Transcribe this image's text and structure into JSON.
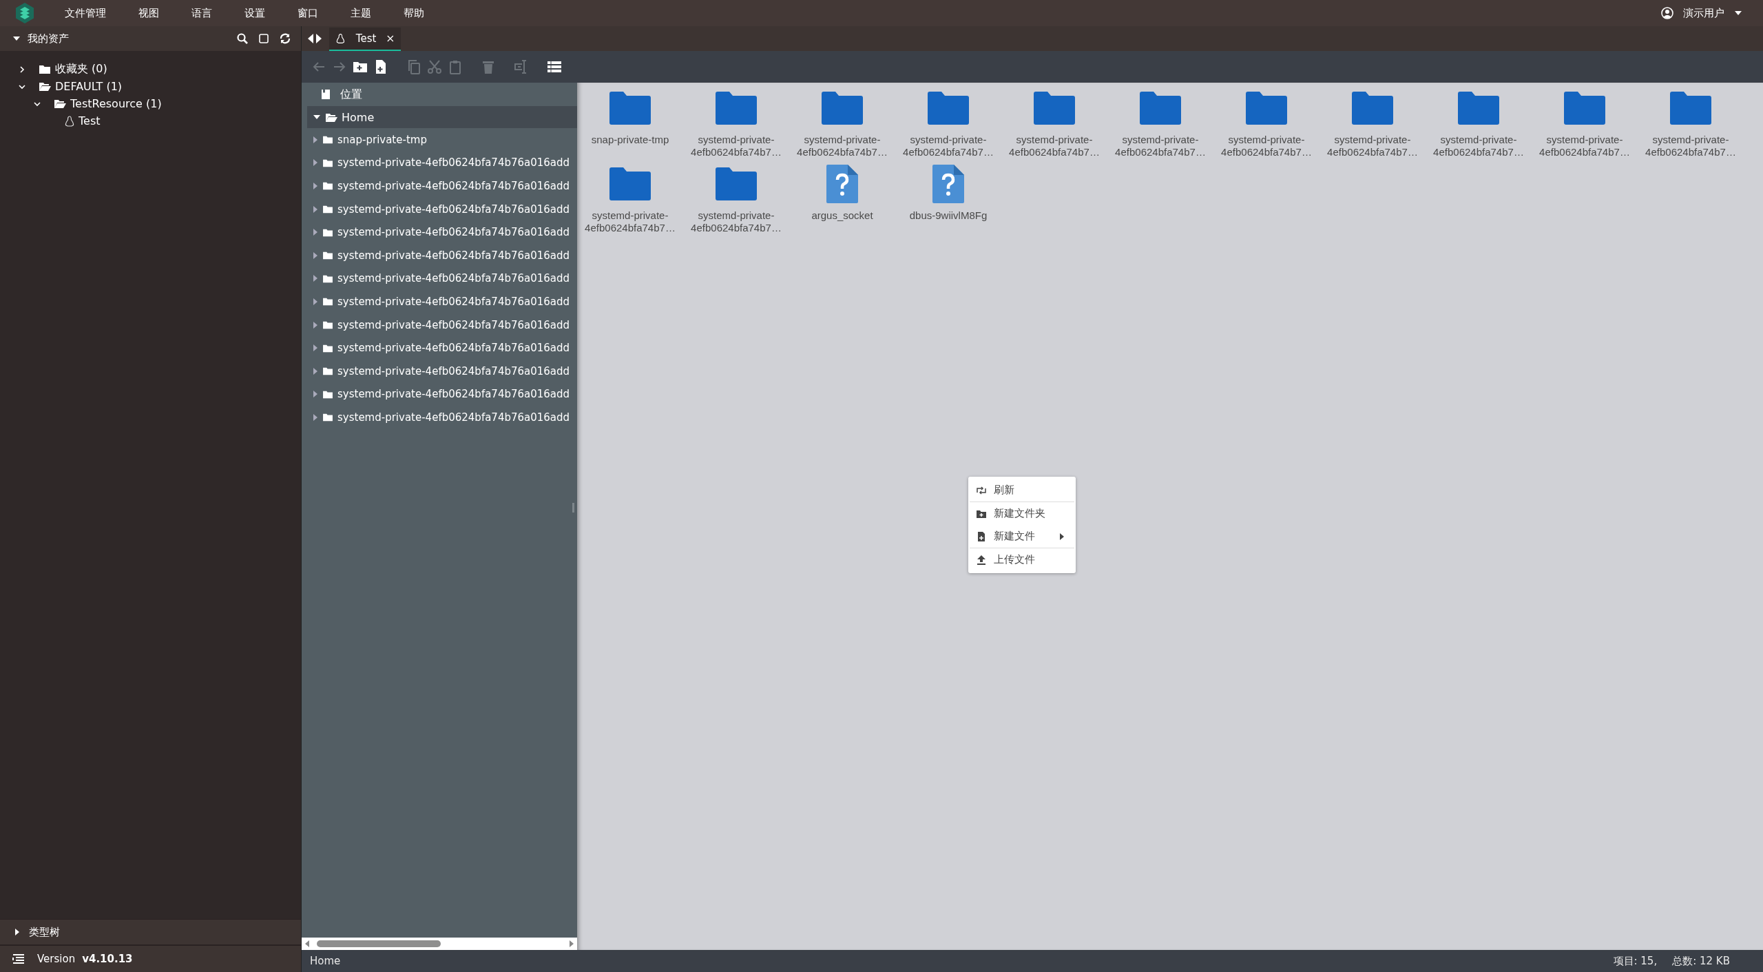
{
  "menu_bar": {
    "items": [
      "文件管理",
      "视图",
      "语言",
      "设置",
      "窗口",
      "主题",
      "帮助"
    ],
    "user": "演示用户"
  },
  "sidebar": {
    "title": "我的资产",
    "tree": [
      {
        "label": "收藏夹 (0)",
        "kind": "folder",
        "expanded": false
      },
      {
        "label": "DEFAULT (1)",
        "kind": "folder",
        "expanded": true,
        "children": [
          {
            "label": "TestResource (1)",
            "kind": "folder",
            "expanded": true,
            "children": [
              {
                "label": "Test",
                "kind": "linux"
              }
            ]
          }
        ]
      }
    ],
    "type_tree": {
      "label": "类型树",
      "expanded": false
    },
    "version": {
      "label": "Version",
      "value": "v4.10.13"
    }
  },
  "tabs": [
    {
      "label": "Test",
      "selected": true
    }
  ],
  "toolbar": [
    {
      "kind": "back",
      "disabled": true
    },
    {
      "kind": "forward",
      "disabled": true
    },
    {
      "kind": "new-folder",
      "disabled": false
    },
    {
      "kind": "new-file",
      "disabled": false
    },
    {
      "kind": "copy",
      "disabled": true
    },
    {
      "kind": "cut",
      "disabled": true
    },
    {
      "kind": "paste",
      "disabled": true
    },
    {
      "kind": "delete",
      "disabled": true
    },
    {
      "kind": "rename",
      "disabled": true
    },
    {
      "kind": "list-view",
      "disabled": false
    }
  ],
  "location_tree": {
    "header": "位置",
    "root": {
      "label": "Home",
      "expanded": true,
      "selected": true,
      "children": [
        {
          "label": "snap-private-tmp",
          "expanded": false
        },
        {
          "label": "systemd-private-4efb0624bfa74b76a016add",
          "expanded": false
        },
        {
          "label": "systemd-private-4efb0624bfa74b76a016add",
          "expanded": false
        },
        {
          "label": "systemd-private-4efb0624bfa74b76a016add",
          "expanded": false
        },
        {
          "label": "systemd-private-4efb0624bfa74b76a016add",
          "expanded": false
        },
        {
          "label": "systemd-private-4efb0624bfa74b76a016add",
          "expanded": false
        },
        {
          "label": "systemd-private-4efb0624bfa74b76a016add",
          "expanded": false
        },
        {
          "label": "systemd-private-4efb0624bfa74b76a016add",
          "expanded": false
        },
        {
          "label": "systemd-private-4efb0624bfa74b76a016add",
          "expanded": false
        },
        {
          "label": "systemd-private-4efb0624bfa74b76a016add",
          "expanded": false
        },
        {
          "label": "systemd-private-4efb0624bfa74b76a016add",
          "expanded": false
        },
        {
          "label": "systemd-private-4efb0624bfa74b76a016add",
          "expanded": false
        },
        {
          "label": "systemd-private-4efb0624bfa74b76a016add",
          "expanded": false
        }
      ]
    }
  },
  "files": [
    {
      "name": "snap-private-tmp",
      "kind": "folder"
    },
    {
      "name": "systemd-private-4efb0624bfa74b7…",
      "kind": "folder"
    },
    {
      "name": "systemd-private-4efb0624bfa74b7…",
      "kind": "folder"
    },
    {
      "name": "systemd-private-4efb0624bfa74b7…",
      "kind": "folder"
    },
    {
      "name": "systemd-private-4efb0624bfa74b7…",
      "kind": "folder"
    },
    {
      "name": "systemd-private-4efb0624bfa74b7…",
      "kind": "folder"
    },
    {
      "name": "systemd-private-4efb0624bfa74b7…",
      "kind": "folder"
    },
    {
      "name": "systemd-private-4efb0624bfa74b7…",
      "kind": "folder"
    },
    {
      "name": "systemd-private-4efb0624bfa74b7…",
      "kind": "folder"
    },
    {
      "name": "systemd-private-4efb0624bfa74b7…",
      "kind": "folder"
    },
    {
      "name": "systemd-private-4efb0624bfa74b7…",
      "kind": "folder"
    },
    {
      "name": "systemd-private-4efb0624bfa74b7…",
      "kind": "folder"
    },
    {
      "name": "systemd-private-4efb0624bfa74b7…",
      "kind": "folder"
    },
    {
      "name": "argus_socket",
      "kind": "unknown"
    },
    {
      "name": "dbus-9wiivlM8Fg",
      "kind": "unknown"
    }
  ],
  "context_menu": [
    {
      "label": "刷新",
      "kind": "refresh",
      "submenu": false,
      "divider_after": true
    },
    {
      "label": "新建文件夹",
      "kind": "new-folder",
      "submenu": false,
      "divider_after": false
    },
    {
      "label": "新建文件",
      "kind": "new-file",
      "submenu": true,
      "divider_after": true
    },
    {
      "label": "上传文件",
      "kind": "upload",
      "submenu": false,
      "divider_after": false
    }
  ],
  "status_bar": {
    "path": "Home",
    "items": "项目: 15,",
    "total": "总数: 12 KB"
  }
}
